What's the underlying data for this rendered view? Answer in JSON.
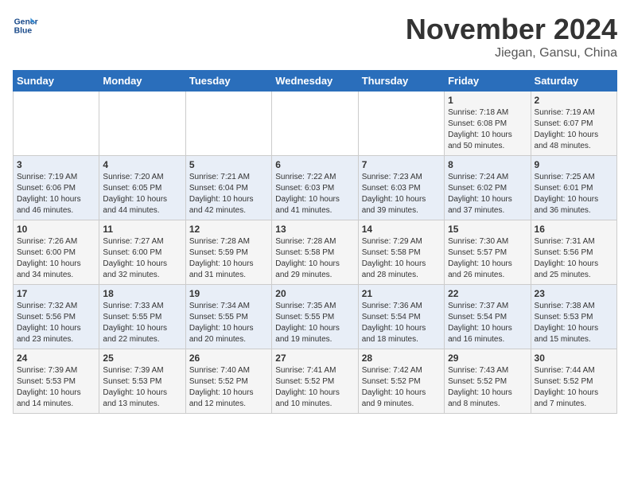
{
  "header": {
    "logo_line1": "General",
    "logo_line2": "Blue",
    "month_title": "November 2024",
    "location": "Jiegan, Gansu, China"
  },
  "weekdays": [
    "Sunday",
    "Monday",
    "Tuesday",
    "Wednesday",
    "Thursday",
    "Friday",
    "Saturday"
  ],
  "weeks": [
    [
      {
        "day": "",
        "info": ""
      },
      {
        "day": "",
        "info": ""
      },
      {
        "day": "",
        "info": ""
      },
      {
        "day": "",
        "info": ""
      },
      {
        "day": "",
        "info": ""
      },
      {
        "day": "1",
        "info": "Sunrise: 7:18 AM\nSunset: 6:08 PM\nDaylight: 10 hours\nand 50 minutes."
      },
      {
        "day": "2",
        "info": "Sunrise: 7:19 AM\nSunset: 6:07 PM\nDaylight: 10 hours\nand 48 minutes."
      }
    ],
    [
      {
        "day": "3",
        "info": "Sunrise: 7:19 AM\nSunset: 6:06 PM\nDaylight: 10 hours\nand 46 minutes."
      },
      {
        "day": "4",
        "info": "Sunrise: 7:20 AM\nSunset: 6:05 PM\nDaylight: 10 hours\nand 44 minutes."
      },
      {
        "day": "5",
        "info": "Sunrise: 7:21 AM\nSunset: 6:04 PM\nDaylight: 10 hours\nand 42 minutes."
      },
      {
        "day": "6",
        "info": "Sunrise: 7:22 AM\nSunset: 6:03 PM\nDaylight: 10 hours\nand 41 minutes."
      },
      {
        "day": "7",
        "info": "Sunrise: 7:23 AM\nSunset: 6:03 PM\nDaylight: 10 hours\nand 39 minutes."
      },
      {
        "day": "8",
        "info": "Sunrise: 7:24 AM\nSunset: 6:02 PM\nDaylight: 10 hours\nand 37 minutes."
      },
      {
        "day": "9",
        "info": "Sunrise: 7:25 AM\nSunset: 6:01 PM\nDaylight: 10 hours\nand 36 minutes."
      }
    ],
    [
      {
        "day": "10",
        "info": "Sunrise: 7:26 AM\nSunset: 6:00 PM\nDaylight: 10 hours\nand 34 minutes."
      },
      {
        "day": "11",
        "info": "Sunrise: 7:27 AM\nSunset: 6:00 PM\nDaylight: 10 hours\nand 32 minutes."
      },
      {
        "day": "12",
        "info": "Sunrise: 7:28 AM\nSunset: 5:59 PM\nDaylight: 10 hours\nand 31 minutes."
      },
      {
        "day": "13",
        "info": "Sunrise: 7:28 AM\nSunset: 5:58 PM\nDaylight: 10 hours\nand 29 minutes."
      },
      {
        "day": "14",
        "info": "Sunrise: 7:29 AM\nSunset: 5:58 PM\nDaylight: 10 hours\nand 28 minutes."
      },
      {
        "day": "15",
        "info": "Sunrise: 7:30 AM\nSunset: 5:57 PM\nDaylight: 10 hours\nand 26 minutes."
      },
      {
        "day": "16",
        "info": "Sunrise: 7:31 AM\nSunset: 5:56 PM\nDaylight: 10 hours\nand 25 minutes."
      }
    ],
    [
      {
        "day": "17",
        "info": "Sunrise: 7:32 AM\nSunset: 5:56 PM\nDaylight: 10 hours\nand 23 minutes."
      },
      {
        "day": "18",
        "info": "Sunrise: 7:33 AM\nSunset: 5:55 PM\nDaylight: 10 hours\nand 22 minutes."
      },
      {
        "day": "19",
        "info": "Sunrise: 7:34 AM\nSunset: 5:55 PM\nDaylight: 10 hours\nand 20 minutes."
      },
      {
        "day": "20",
        "info": "Sunrise: 7:35 AM\nSunset: 5:55 PM\nDaylight: 10 hours\nand 19 minutes."
      },
      {
        "day": "21",
        "info": "Sunrise: 7:36 AM\nSunset: 5:54 PM\nDaylight: 10 hours\nand 18 minutes."
      },
      {
        "day": "22",
        "info": "Sunrise: 7:37 AM\nSunset: 5:54 PM\nDaylight: 10 hours\nand 16 minutes."
      },
      {
        "day": "23",
        "info": "Sunrise: 7:38 AM\nSunset: 5:53 PM\nDaylight: 10 hours\nand 15 minutes."
      }
    ],
    [
      {
        "day": "24",
        "info": "Sunrise: 7:39 AM\nSunset: 5:53 PM\nDaylight: 10 hours\nand 14 minutes."
      },
      {
        "day": "25",
        "info": "Sunrise: 7:39 AM\nSunset: 5:53 PM\nDaylight: 10 hours\nand 13 minutes."
      },
      {
        "day": "26",
        "info": "Sunrise: 7:40 AM\nSunset: 5:52 PM\nDaylight: 10 hours\nand 12 minutes."
      },
      {
        "day": "27",
        "info": "Sunrise: 7:41 AM\nSunset: 5:52 PM\nDaylight: 10 hours\nand 10 minutes."
      },
      {
        "day": "28",
        "info": "Sunrise: 7:42 AM\nSunset: 5:52 PM\nDaylight: 10 hours\nand 9 minutes."
      },
      {
        "day": "29",
        "info": "Sunrise: 7:43 AM\nSunset: 5:52 PM\nDaylight: 10 hours\nand 8 minutes."
      },
      {
        "day": "30",
        "info": "Sunrise: 7:44 AM\nSunset: 5:52 PM\nDaylight: 10 hours\nand 7 minutes."
      }
    ]
  ]
}
